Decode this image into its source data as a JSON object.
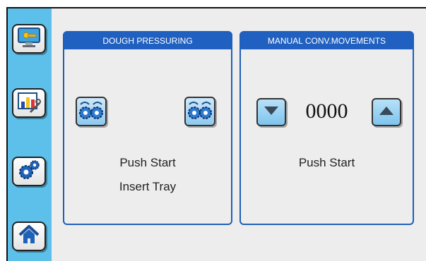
{
  "nav": {
    "items": [
      {
        "name": "login-icon"
      },
      {
        "name": "maintenance-icon"
      },
      {
        "name": "settings-icon"
      },
      {
        "name": "home-icon"
      }
    ]
  },
  "dough_panel": {
    "title": "DOUGH PRESSURING",
    "message_line1": "Push Start",
    "message_line2": "Insert Tray",
    "buttons": [
      "rollers-gear-icon",
      "rollers-gear-icon"
    ]
  },
  "conveyor_panel": {
    "title": "MANUAL CONV.MOVEMENTS",
    "counter": "0000",
    "message": "Push Start",
    "buttons": [
      "down-arrow-icon",
      "up-arrow-icon"
    ]
  },
  "colors": {
    "sidebar": "#5cc0ea",
    "panel_header": "#2060c0",
    "button_blue": "#8fc8ee"
  }
}
